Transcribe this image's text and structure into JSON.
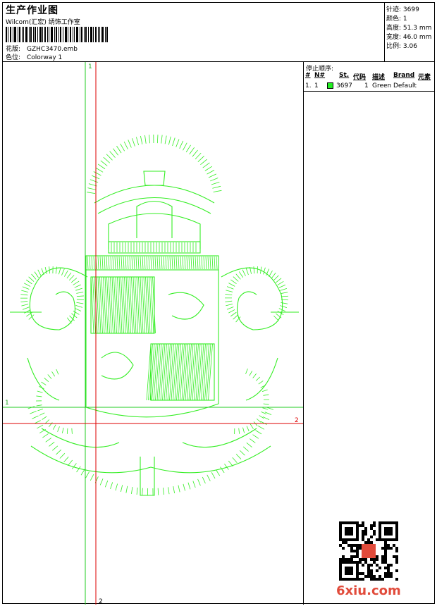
{
  "header": {
    "title": "生产作业图",
    "studio": "Wilcom(汇宏) 绣饰工作室",
    "barcode_label": "barcode",
    "design_label": "花版:",
    "design_value": "GZHC3470.emb",
    "colorway_label": "色位:",
    "colorway_value": "Colorway 1"
  },
  "stats": {
    "stitches_label": "针迹:",
    "stitches": "3699",
    "colors_label": "颜色:",
    "colors": "1",
    "height_label": "高度:",
    "height": "51.3 mm",
    "width_label": "宽度:",
    "width": "46.0 mm",
    "ratio_label": "比例:",
    "ratio": "3.06"
  },
  "canvas": {
    "guide_green_v": "1",
    "guide_green_h": "1",
    "guide_red_h": "2",
    "guide_red_v": "2",
    "thread_color": "#33ee22",
    "guide_green_color": "#22cc22",
    "guide_red_color": "#dd0000"
  },
  "stop_sequence": {
    "title": "停止顺序:",
    "columns": [
      "#",
      "N#",
      "St.",
      "代码",
      "描述",
      "Brand",
      "元素"
    ],
    "rows": [
      {
        "idx": "1.",
        "num": "1",
        "swatch": "#22ee22",
        "st": "3697",
        "code": "1",
        "desc": "Green",
        "brand": "Default"
      }
    ]
  },
  "watermark": {
    "text": "6xiu.com",
    "seal": "印"
  }
}
